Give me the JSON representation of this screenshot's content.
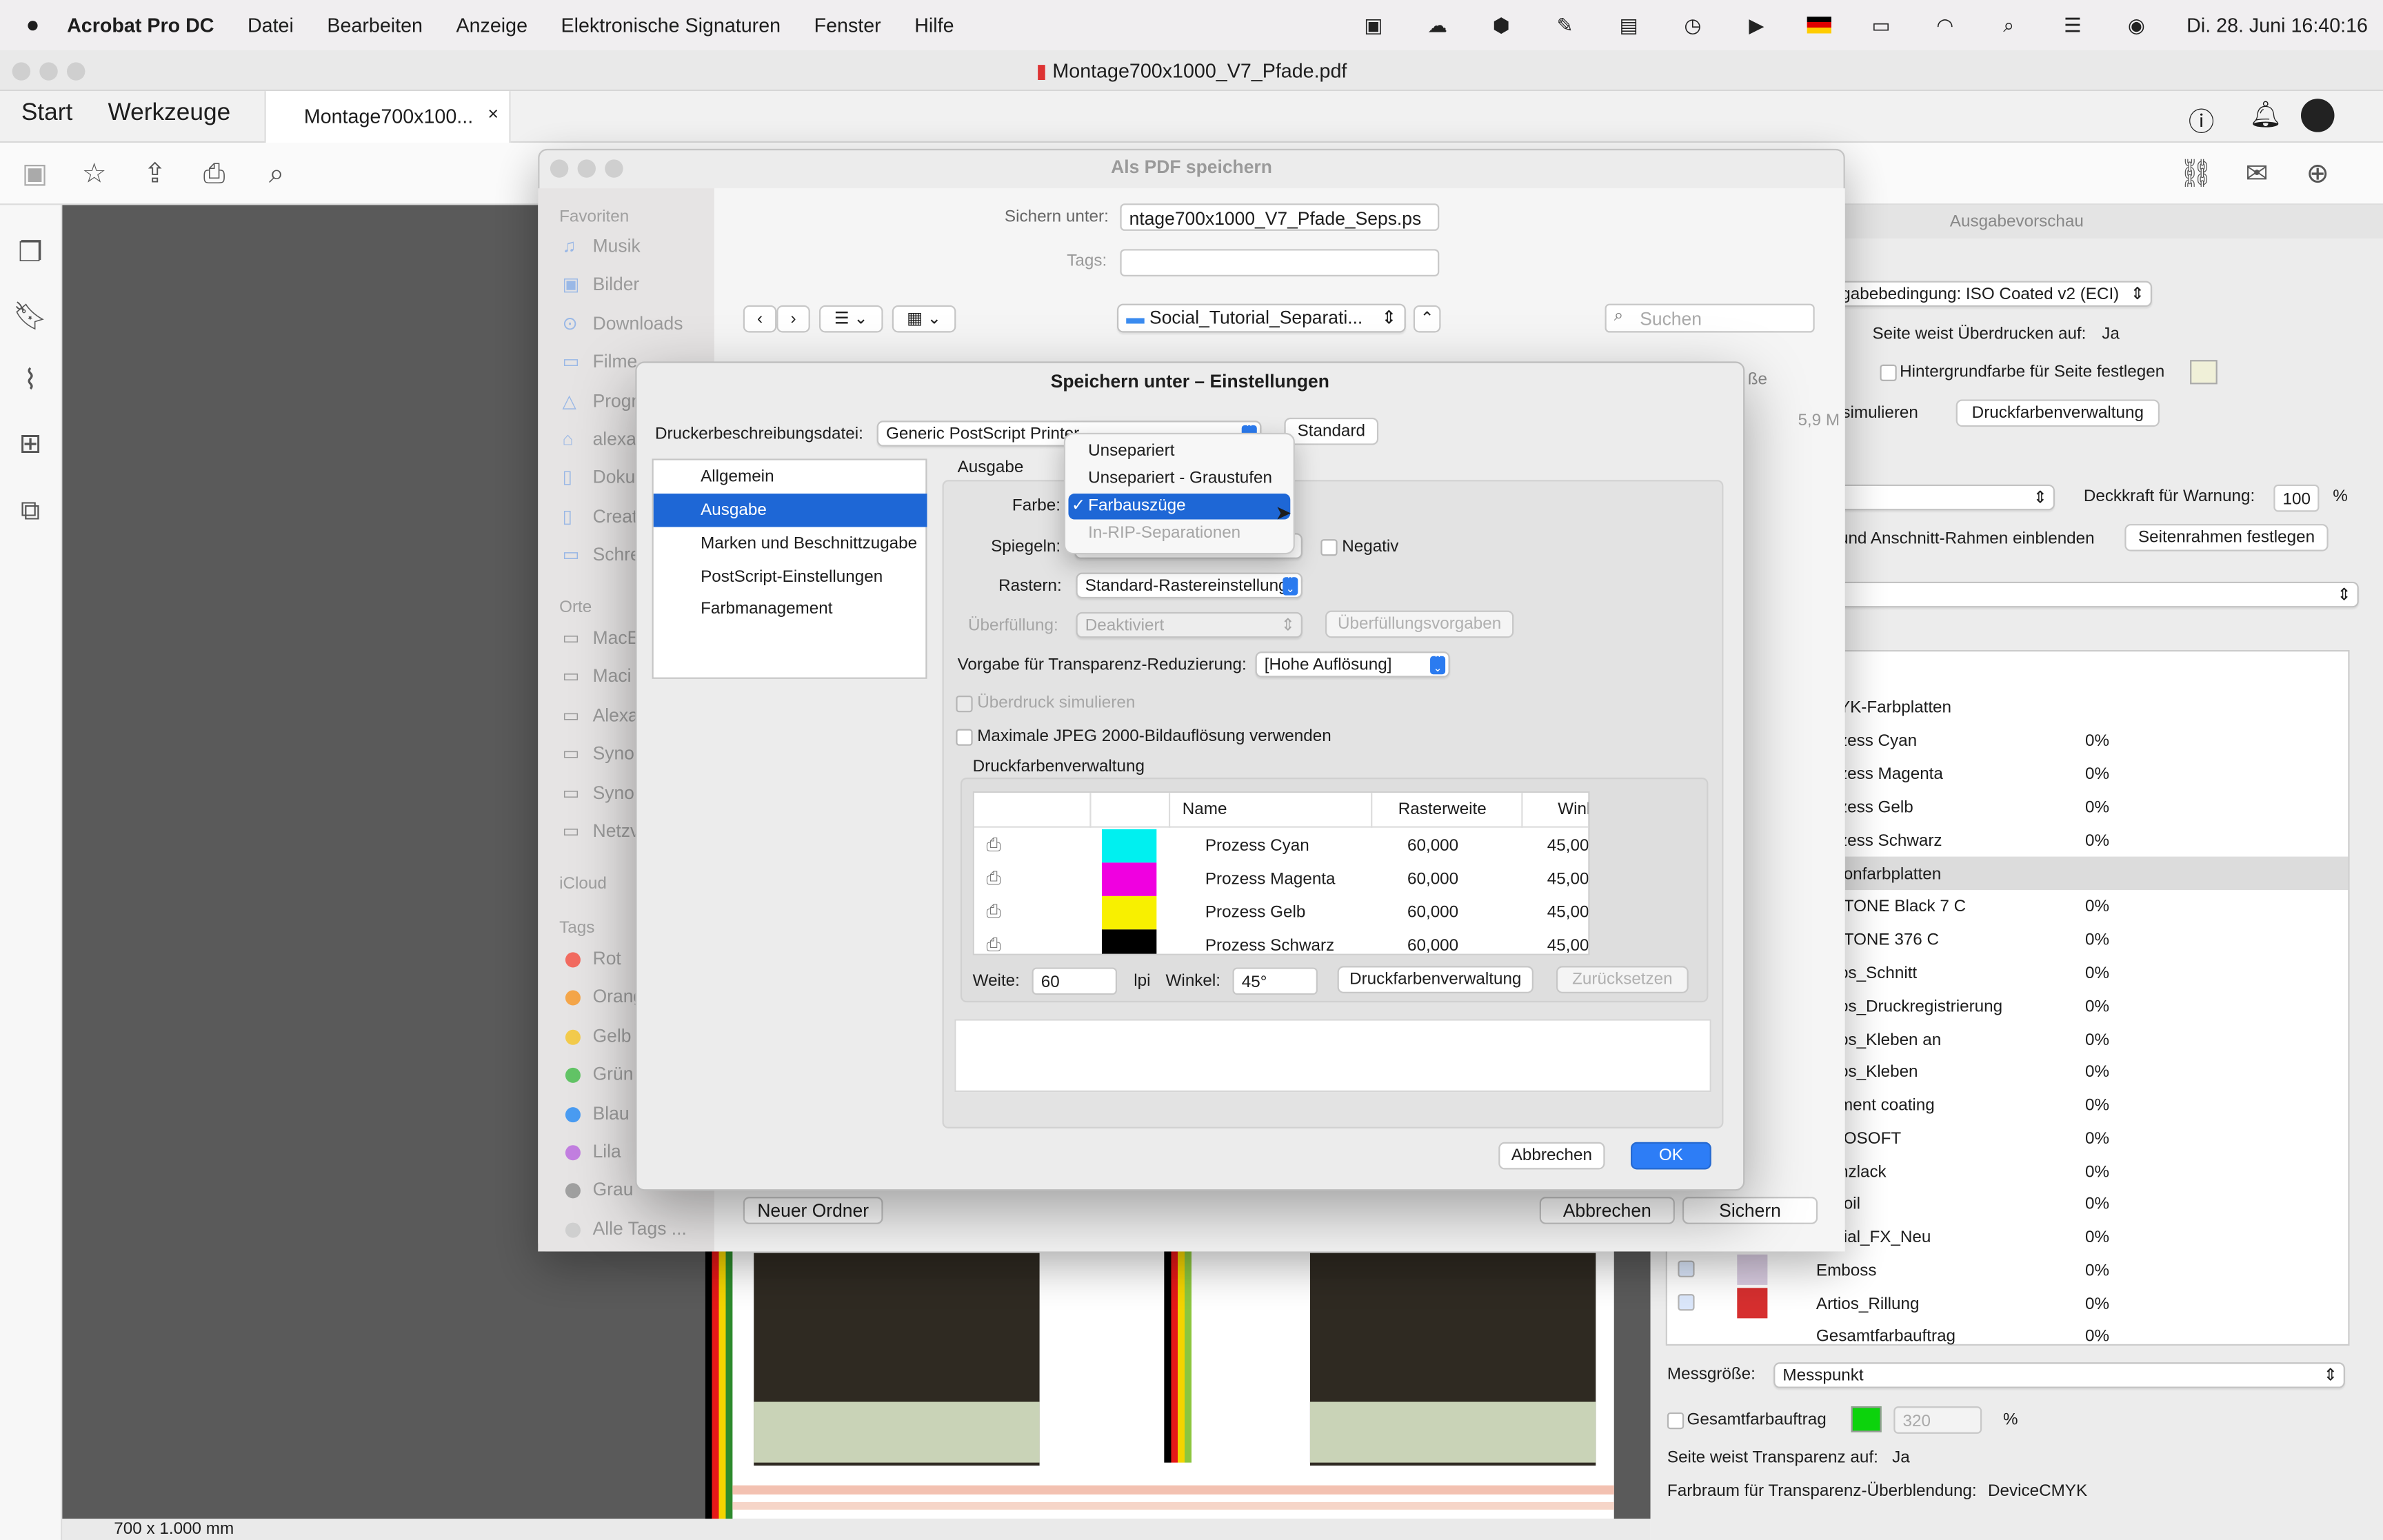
{
  "menubar": {
    "app": "Acrobat Pro DC",
    "items": [
      "Datei",
      "Bearbeiten",
      "Anzeige",
      "Elektronische Signaturen",
      "Fenster",
      "Hilfe"
    ],
    "clock": "Di. 28. Juni  16:40:16"
  },
  "window": {
    "title": "Montage700x1000_V7_Pfade.pdf",
    "tabs": {
      "start": "Start",
      "tools": "Werkzeuge",
      "doc": "Montage700x100..."
    },
    "doc_size": "700 x 1.000 mm"
  },
  "output_preview": {
    "title": "Ausgabevorschau",
    "condition": "sgabebedingung: ISO Coated v2 (ECI)",
    "overprint_label": "Seite weist Überdrucken auf:",
    "overprint_value": "Ja",
    "bg_label": "Hintergrundfarbe für Seite festlegen",
    "simulate": "simulieren",
    "ink_mgr": "Druckfarbenverwaltung",
    "opacity_label": "Deckkraft für Warnung:",
    "opacity_value": "100",
    "opacity_unit": "%",
    "frames_label": "und Anschnitt-Rahmen einblenden",
    "frames_btn": "Seitenrahmen festlegen",
    "rows": [
      {
        "name": "YK-Farbplatten",
        "pct": ""
      },
      {
        "name": "zess Cyan",
        "pct": "0%"
      },
      {
        "name": "zess Magenta",
        "pct": "0%"
      },
      {
        "name": "zess Gelb",
        "pct": "0%"
      },
      {
        "name": "zess Schwarz",
        "pct": "0%"
      },
      {
        "name": "tonfarbplatten",
        "pct": ""
      },
      {
        "name": "ITONE Black 7 C",
        "pct": "0%"
      },
      {
        "name": "ITONE 376 C",
        "pct": "0%"
      },
      {
        "name": "os_Schnitt",
        "pct": "0%"
      },
      {
        "name": "os_Druckregistrierung",
        "pct": "0%"
      },
      {
        "name": "os_Kleben an",
        "pct": "0%"
      },
      {
        "name": "os_Kleben",
        "pct": "0%"
      },
      {
        "name": "ment coating",
        "pct": "0%"
      },
      {
        "name": "IOSOFT",
        "pct": "0%"
      },
      {
        "name": "nzlack",
        "pct": "0%"
      },
      {
        "name": "foil",
        "pct": "0%"
      },
      {
        "name": "tial_FX_Neu",
        "pct": "0%"
      },
      {
        "name": "Emboss",
        "pct": "0%"
      },
      {
        "name": "Artios_Rillung",
        "pct": "0%"
      },
      {
        "name": "Gesamtfarbauftrag",
        "pct": "0%"
      }
    ],
    "messgroesse_label": "Messgröße:",
    "messgroesse_value": "Messpunkt",
    "gesamt_label": "Gesamtfarbauftrag",
    "gesamt_value": "320",
    "gesamt_unit": "%",
    "transp_label": "Seite weist Transparenz auf:",
    "transp_value": "Ja",
    "farbraum_label": "Farbraum für Transparenz-Überblendung:",
    "farbraum_value": "DeviceCMYK"
  },
  "save_dialog": {
    "title": "Als PDF speichern",
    "save_as_label": "Sichern unter:",
    "save_as_value": "ntage700x1000_V7_Pfade_Seps.ps",
    "tags_label": "Tags:",
    "folder": "Social_Tutorial_Separati...",
    "search_placeholder": "Suchen",
    "col_size": "ße",
    "size_value": "5,9 M",
    "fav_head": "Favoriten",
    "favorites": [
      "Musik",
      "Bilder",
      "Downloads",
      "Filme",
      "Progr",
      "alexa",
      "Doku",
      "Creat",
      "Schre"
    ],
    "places_head": "Orte",
    "places": [
      "MacE",
      "Maci",
      "Alexa",
      "Syno",
      "Syno",
      "Netzv"
    ],
    "icloud_head": "iCloud",
    "tags_head": "Tags",
    "tags": [
      {
        "name": "Rot",
        "color": "#f26b60"
      },
      {
        "name": "Orang",
        "color": "#f5a64a"
      },
      {
        "name": "Gelb",
        "color": "#f3cb4c"
      },
      {
        "name": "Grün",
        "color": "#62c466"
      },
      {
        "name": "Blau",
        "color": "#4a9cf2"
      },
      {
        "name": "Lila",
        "color": "#c27fe0"
      },
      {
        "name": "Grau",
        "color": "#a0a0a0"
      },
      {
        "name": "Alle Tags ...",
        "color": "#cfcfcf"
      }
    ],
    "new_folder": "Neuer Ordner",
    "cancel": "Abbrechen",
    "save": "Sichern"
  },
  "settings": {
    "title": "Speichern unter – Einstellungen",
    "ppd_label": "Druckerbeschreibungsdatei:",
    "ppd_value": "Generic PostScript Printer",
    "standard": "Standard",
    "nav": [
      "Allgemein",
      "Ausgabe",
      "Marken und Beschnittzugabe",
      "PostScript-Einstellungen",
      "Farbmanagement"
    ],
    "section": "Ausgabe",
    "farbe_label": "Farbe:",
    "spiegeln_label": "Spiegeln:",
    "negativ": "Negativ",
    "rastern_label": "Rastern:",
    "rastern_value": "Standard-Rastereinstellung",
    "ueberfuellung_label": "Überfüllung:",
    "ueberfuellung_value": "Deaktiviert",
    "ueberfuellung_btn": "Überfüllungsvorgaben",
    "transp_label": "Vorgabe für Transparenz-Reduzierung:",
    "transp_value": "[Hohe Auflösung]",
    "ueberdruck": "Überdruck simulieren",
    "jpeg": "Maximale JPEG 2000-Bildauflösung verwenden",
    "ink_group": "Druckfarbenverwaltung",
    "ink_cols": [
      "Name",
      "Rasterweite",
      "Winkel"
    ],
    "inks": [
      {
        "name": "Prozess Cyan",
        "ruling": "60,000",
        "angle": "45,00",
        "color": "#00f0f0"
      },
      {
        "name": "Prozess Magenta",
        "ruling": "60,000",
        "angle": "45,00",
        "color": "#f000e0"
      },
      {
        "name": "Prozess Gelb",
        "ruling": "60,000",
        "angle": "45,00",
        "color": "#f8f000"
      },
      {
        "name": "Prozess Schwarz",
        "ruling": "60,000",
        "angle": "45,00",
        "color": "#000000"
      }
    ],
    "weite_label": "Weite:",
    "weite_value": "60",
    "lpi": "lpi",
    "winkel_label": "Winkel:",
    "winkel_value": "45°",
    "ink_mgr_btn": "Druckfarbenverwaltung",
    "reset_btn": "Zurücksetzen",
    "cancel": "Abbrechen",
    "ok": "OK",
    "farbe_menu": [
      "Unsepariert",
      "Unsepariert - Graustufen",
      "Farbauszüge",
      "In-RIP-Separationen"
    ],
    "check": "✓"
  }
}
